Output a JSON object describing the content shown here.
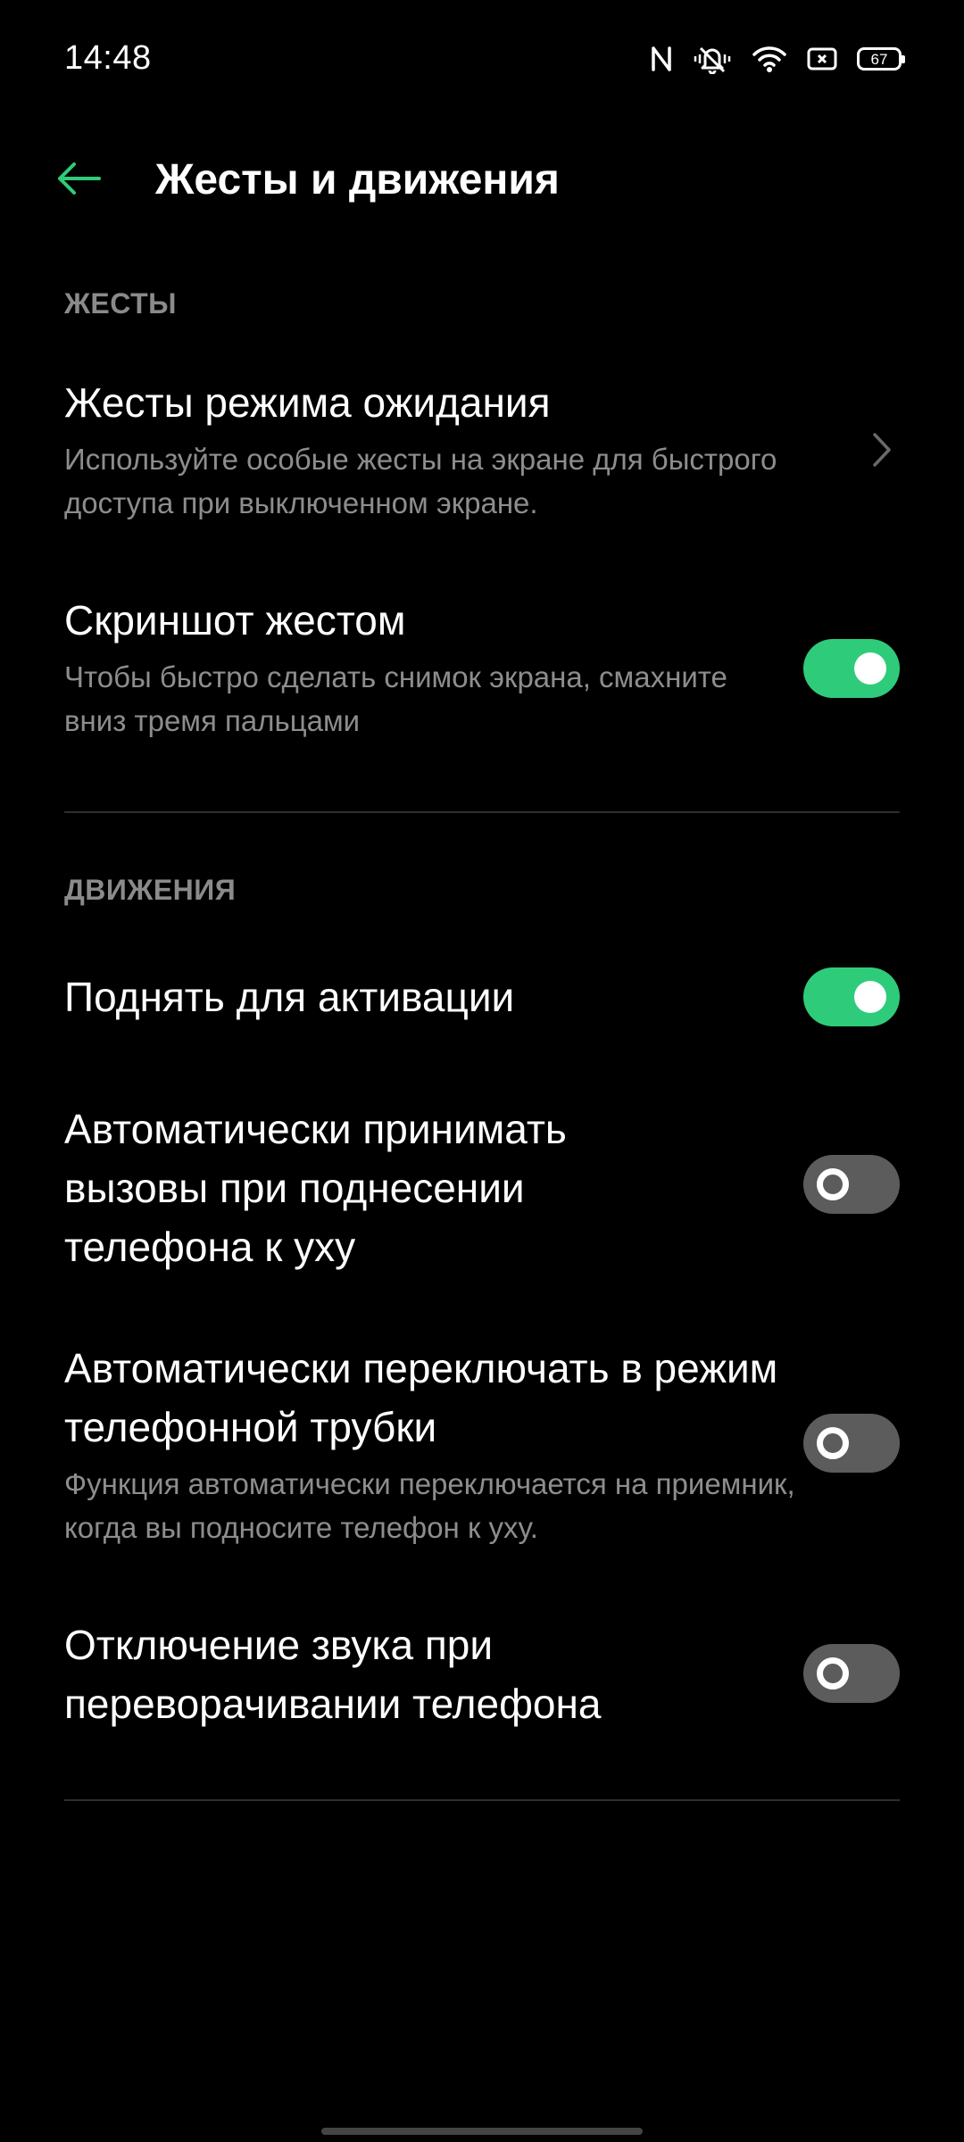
{
  "status_bar": {
    "time": "14:48",
    "icons": [
      "nfc-icon",
      "vibrate-icon",
      "wifi-icon",
      "screen-record-icon",
      "battery-icon"
    ],
    "battery_level": "67"
  },
  "header": {
    "back_icon": "arrow-left-icon",
    "title": "Жесты и движения"
  },
  "sections": {
    "gestures": {
      "label": "ЖЕСТЫ",
      "items": [
        {
          "title": "Жесты режима ожидания",
          "desc": "Используйте особые жесты на экране для быстрого доступа при выключенном экране.",
          "control": "chevron-right-icon"
        },
        {
          "title": "Скриншот жестом",
          "desc": "Чтобы быстро сделать снимок экрана, смахните вниз тремя пальцами",
          "toggle": "on"
        }
      ]
    },
    "motions": {
      "label": "ДВИЖЕНИЯ",
      "items": [
        {
          "title": "Поднять для активации",
          "toggle": "on"
        },
        {
          "title": "Автоматически принимать вызовы при поднесении телефона к уху",
          "toggle": "off"
        },
        {
          "title": "Автоматически переключать в режим телефонной трубки",
          "desc": "Функция автоматически переключается на приемник, когда вы подносите телефон к уху.",
          "toggle": "off"
        },
        {
          "title": "Отключение звука при переворачивании телефона",
          "toggle": "off"
        }
      ]
    }
  },
  "colors": {
    "accent": "#2ecc7a",
    "background": "#000000",
    "toggle_off": "#5c5c5c",
    "secondary_text": "#8d8d8d"
  }
}
